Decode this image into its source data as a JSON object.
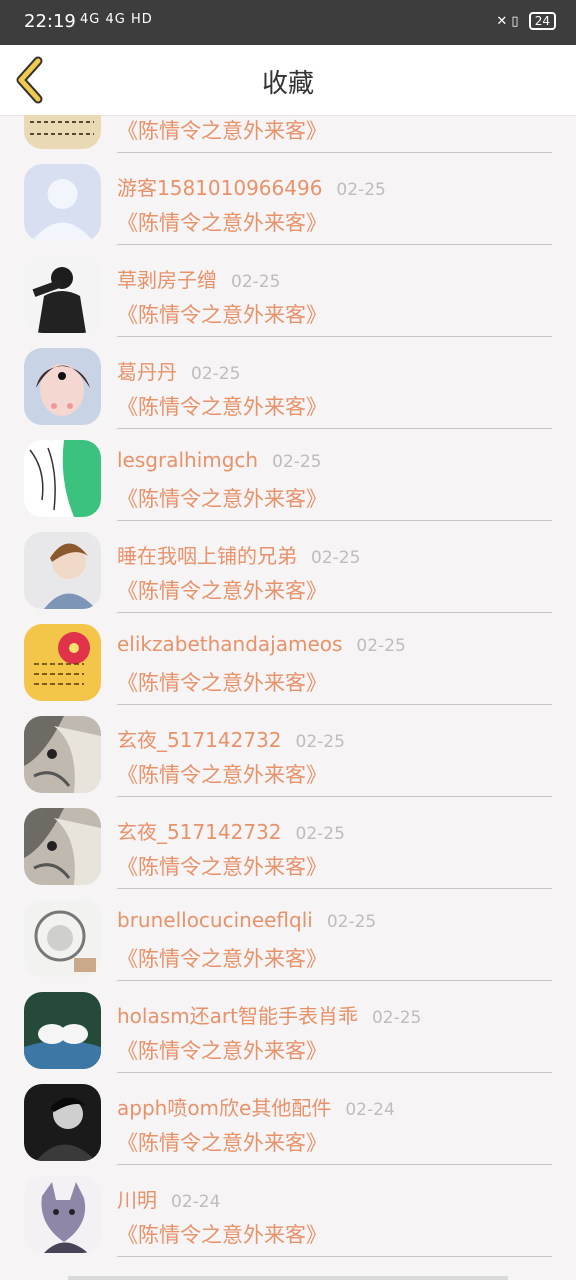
{
  "status": {
    "time": "22:19",
    "signal_text": "4G 4G HD",
    "battery": "24"
  },
  "header": {
    "title": "收藏",
    "back_icon": "chevron-left-icon",
    "accent": "#f2c94c"
  },
  "colors": {
    "name": "#e8926a",
    "date": "#bdbdbd",
    "divider": "#c8c6c6"
  },
  "items": [
    {
      "name": "",
      "date": "",
      "book": "《陈情令之意外来客》",
      "avatar": "calligraphy"
    },
    {
      "name": "游客1581010966496",
      "date": "02-25",
      "book": "《陈情令之意外来客》",
      "avatar": "default"
    },
    {
      "name": "草剥房子缯",
      "date": "02-25",
      "book": "《陈情令之意外来客》",
      "avatar": "person-dark"
    },
    {
      "name": "葛丹丹",
      "date": "02-25",
      "book": "《陈情令之意外来客》",
      "avatar": "girl"
    },
    {
      "name": "lesgralhimgch",
      "date": "02-25",
      "book": "《陈情令之意外来客》",
      "avatar": "green-sketch"
    },
    {
      "name": "睡在我咽上铺的兄弟",
      "date": "02-25",
      "book": "《陈情令之意外来客》",
      "avatar": "boy"
    },
    {
      "name": "elikzabethandajameos",
      "date": "02-25",
      "book": "《陈情令之意外来客》",
      "avatar": "flower"
    },
    {
      "name": "玄夜_517142732",
      "date": "02-25",
      "book": "《陈情令之意外来客》",
      "avatar": "anime"
    },
    {
      "name": "玄夜_517142732",
      "date": "02-25",
      "book": "《陈情令之意外来客》",
      "avatar": "anime"
    },
    {
      "name": "brunellocucineeflqli",
      "date": "02-25",
      "book": "《陈情令之意外来客》",
      "avatar": "lion"
    },
    {
      "name": "holasm还art智能手表肖乖",
      "date": "02-25",
      "book": "《陈情令之意外来客》",
      "avatar": "doves"
    },
    {
      "name": "apph喷om欣e其他配件",
      "date": "02-24",
      "book": "《陈情令之意外来客》",
      "avatar": "bw-person"
    },
    {
      "name": "川明",
      "date": "02-24",
      "book": "《陈情令之意外来客》",
      "avatar": "wolf"
    }
  ]
}
